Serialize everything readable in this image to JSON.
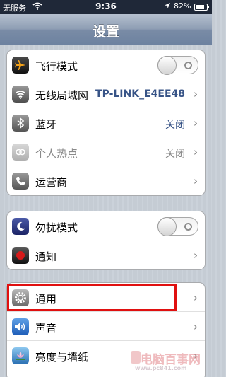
{
  "status_bar": {
    "carrier": "无服务",
    "time": "9:36",
    "battery_percent": "82%",
    "battery_level": 0.82
  },
  "nav": {
    "title": "设置"
  },
  "groups": [
    {
      "rows": [
        {
          "label": "飞行模式",
          "icon": "airplane-icon",
          "control": "toggle",
          "state": "off"
        },
        {
          "label": "无线局域网",
          "icon": "wifi-icon",
          "value": "TP-LINK_E4EE48",
          "control": "chevron"
        },
        {
          "label": "蓝牙",
          "icon": "bluetooth-icon",
          "value": "关闭",
          "control": "chevron"
        },
        {
          "label": "个人热点",
          "icon": "hotspot-icon",
          "value": "关闭",
          "control": "chevron",
          "disabled": true
        },
        {
          "label": "运营商",
          "icon": "phone-icon",
          "control": "chevron"
        }
      ]
    },
    {
      "rows": [
        {
          "label": "勿扰模式",
          "icon": "moon-icon",
          "control": "toggle",
          "state": "off"
        },
        {
          "label": "通知",
          "icon": "notification-icon",
          "control": "chevron"
        }
      ]
    },
    {
      "rows": [
        {
          "label": "通用",
          "icon": "gear-icon",
          "control": "chevron",
          "highlighted": true
        },
        {
          "label": "声音",
          "icon": "speaker-icon",
          "control": "chevron"
        },
        {
          "label": "亮度与墙纸",
          "icon": "wallpaper-icon",
          "control": "chevron"
        }
      ]
    }
  ],
  "watermark": {
    "text": "电脑百事网",
    "url": "www.pc841.com"
  },
  "colors": {
    "nav_bar": "#7a8ca6",
    "value_text": "#385487",
    "highlight_box": "#e01010",
    "status_bar": "#1f2838"
  }
}
